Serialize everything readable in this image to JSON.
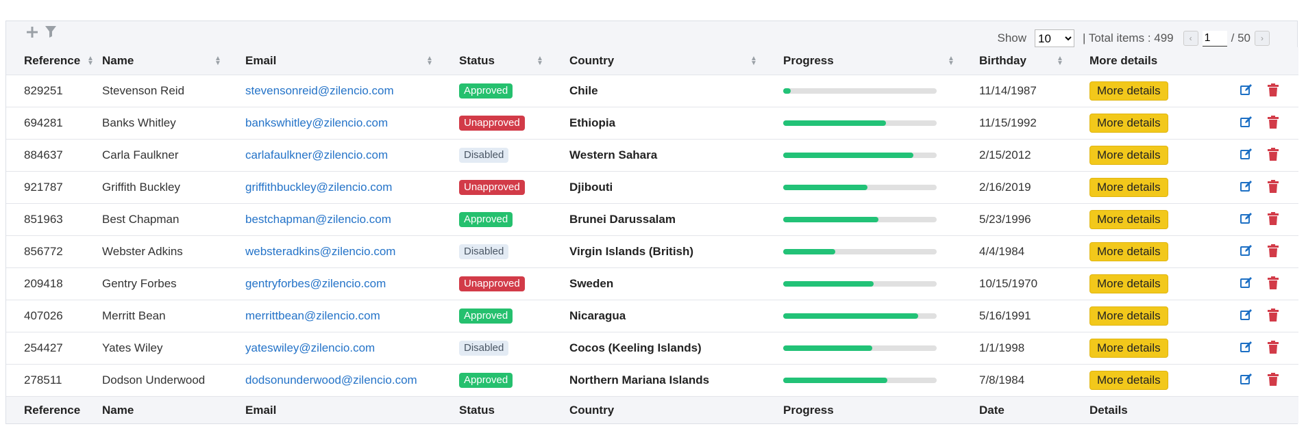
{
  "toolbar": {
    "add_icon": "plus-icon",
    "filter_icon": "filter-icon",
    "show_label": "Show",
    "page_size": "10",
    "page_size_options": [
      "10"
    ],
    "total_label": "| Total items : 499",
    "prev_icon": "chevron-left-icon",
    "next_icon": "chevron-right-icon",
    "current_page": "1",
    "total_pages_label": "/ 50"
  },
  "columns": {
    "reference": "Reference",
    "name": "Name",
    "email": "Email",
    "status": "Status",
    "country": "Country",
    "progress": "Progress",
    "birthday": "Birthday",
    "more": "More details"
  },
  "footer": {
    "reference": "Reference",
    "name": "Name",
    "email": "Email",
    "status": "Status",
    "country": "Country",
    "progress": "Progress",
    "birthday": "Date",
    "more": "Details"
  },
  "more_label": "More details",
  "status_colors": {
    "Approved": "#25c06e",
    "Unapproved": "#d23b48",
    "Disabled": "#e3ebf4"
  },
  "rows": [
    {
      "reference": "829251",
      "name": "Stevenson Reid",
      "email": "stevensonreid@zilencio.com",
      "status": "Approved",
      "country": "Chile",
      "progress": 0.05,
      "birthday": "11/14/1987"
    },
    {
      "reference": "694281",
      "name": "Banks Whitley",
      "email": "bankswhitley@zilencio.com",
      "status": "Unapproved",
      "country": "Ethiopia",
      "progress": 0.67,
      "birthday": "11/15/1992"
    },
    {
      "reference": "884637",
      "name": "Carla Faulkner",
      "email": "carlafaulkner@zilencio.com",
      "status": "Disabled",
      "country": "Western Sahara",
      "progress": 0.85,
      "birthday": "2/15/2012"
    },
    {
      "reference": "921787",
      "name": "Griffith Buckley",
      "email": "griffithbuckley@zilencio.com",
      "status": "Unapproved",
      "country": "Djibouti",
      "progress": 0.55,
      "birthday": "2/16/2019"
    },
    {
      "reference": "851963",
      "name": "Best Chapman",
      "email": "bestchapman@zilencio.com",
      "status": "Approved",
      "country": "Brunei Darussalam",
      "progress": 0.62,
      "birthday": "5/23/1996"
    },
    {
      "reference": "856772",
      "name": "Webster Adkins",
      "email": "websteradkins@zilencio.com",
      "status": "Disabled",
      "country": "Virgin Islands (British)",
      "progress": 0.34,
      "birthday": "4/4/1984"
    },
    {
      "reference": "209418",
      "name": "Gentry Forbes",
      "email": "gentryforbes@zilencio.com",
      "status": "Unapproved",
      "country": "Sweden",
      "progress": 0.59,
      "birthday": "10/15/1970"
    },
    {
      "reference": "407026",
      "name": "Merritt Bean",
      "email": "merrittbean@zilencio.com",
      "status": "Approved",
      "country": "Nicaragua",
      "progress": 0.88,
      "birthday": "5/16/1991"
    },
    {
      "reference": "254427",
      "name": "Yates Wiley",
      "email": "yateswiley@zilencio.com",
      "status": "Disabled",
      "country": "Cocos (Keeling Islands)",
      "progress": 0.58,
      "birthday": "1/1/1998"
    },
    {
      "reference": "278511",
      "name": "Dodson Underwood",
      "email": "dodsonunderwood@zilencio.com",
      "status": "Approved",
      "country": "Northern Mariana Islands",
      "progress": 0.68,
      "birthday": "7/8/1984"
    }
  ]
}
